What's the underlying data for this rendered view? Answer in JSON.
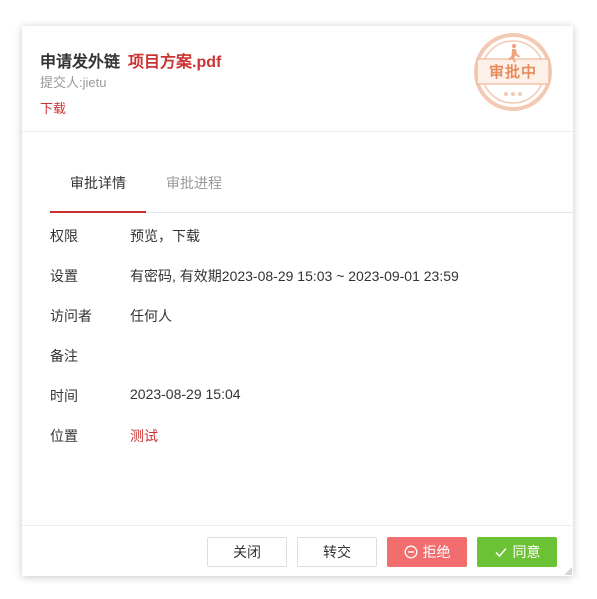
{
  "header": {
    "action": "申请发外链",
    "filename": "项目方案.pdf",
    "submitter": "提交人:jietu",
    "download_label": "下载"
  },
  "stamp": {
    "text": "审批中",
    "color": "#e78b5d"
  },
  "tabs": [
    {
      "label": "审批详情",
      "active": true
    },
    {
      "label": "审批进程",
      "active": false
    }
  ],
  "details": [
    {
      "label": "权限",
      "value": "预览，下载"
    },
    {
      "label": "设置",
      "value": "有密码, 有效期2023-08-29 15:03 ~ 2023-09-01 23:59"
    },
    {
      "label": "访问者",
      "value": "任何人"
    },
    {
      "label": "备注",
      "value": ""
    },
    {
      "label": "时间",
      "value": "2023-08-29 15:04"
    },
    {
      "label": "位置",
      "value": "测试"
    }
  ],
  "footer": {
    "close_label": "关闭",
    "transfer_label": "转交",
    "reject_label": "拒绝",
    "agree_label": "同意"
  },
  "colors": {
    "accent_red": "#c33333",
    "reject": "#f26d6d",
    "agree": "#6cc235"
  }
}
